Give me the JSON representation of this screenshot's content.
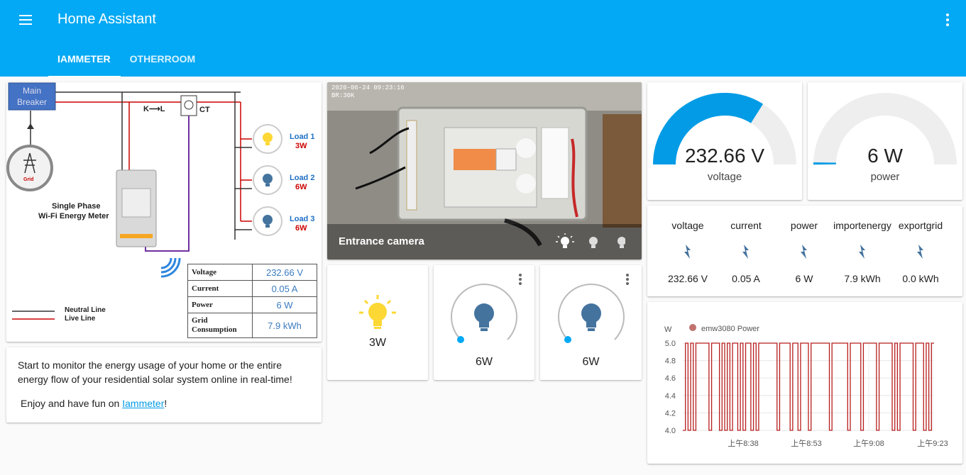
{
  "app": {
    "title": "Home Assistant"
  },
  "tabs": [
    {
      "label": "IAMMETER",
      "active": true
    },
    {
      "label": "OTHERROOM",
      "active": false
    }
  ],
  "diagram": {
    "main_breaker": "Main\nBreaker",
    "direction": "K",
    "direction_to": "L",
    "ct": "CT",
    "grid": "Grid",
    "meter_line1": "Single Phase",
    "meter_line2": "Wi-Fi Energy Meter",
    "loads": [
      {
        "name": "Load 1",
        "value": "3W"
      },
      {
        "name": "Load 2",
        "value": "6W"
      },
      {
        "name": "Load 3",
        "value": "6W"
      }
    ],
    "legend_neutral": "Neutral Line",
    "legend_live": "Live Line",
    "table": [
      {
        "label": "Voltage",
        "value": "232.66 V"
      },
      {
        "label": "Current",
        "value": "0.05 A"
      },
      {
        "label": "Power",
        "value": "6 W"
      },
      {
        "label": "Grid Consumption",
        "value": "7.9 kWh"
      }
    ]
  },
  "markdown": {
    "text1": "Start to monitor the energy usage of your home or the entire energy flow of your residential solar system online in real-time!",
    "enjoy_prefix": "Enjoy and have fun on ",
    "link": "Iammeter",
    "suffix": "!"
  },
  "camera": {
    "title": "Entrance camera",
    "timestamp": "2020-06-24 09:23:16",
    "sub": "BR:30K"
  },
  "gauges": [
    {
      "value": "232.66 V",
      "name": "voltage",
      "fraction": 0.68
    },
    {
      "value": "6 W",
      "name": "power",
      "fraction": 0.01
    }
  ],
  "glance": [
    {
      "name": "voltage",
      "state": "232.66 V",
      "icon": "flash-icon"
    },
    {
      "name": "current",
      "state": "0.05 A",
      "icon": "flash-icon"
    },
    {
      "name": "power",
      "state": "6 W",
      "icon": "flash-icon"
    },
    {
      "name": "importenergy",
      "state": "7.9 kWh",
      "icon": "flash-icon"
    },
    {
      "name": "exportgrid",
      "state": "0.0 kWh",
      "icon": "flash-icon"
    }
  ],
  "lights": [
    {
      "state": "3W",
      "on": true
    },
    {
      "state": "6W",
      "on": false,
      "brightness": 0
    },
    {
      "state": "6W",
      "on": false,
      "brightness": 0
    }
  ],
  "colors": {
    "primary": "#03a9f4",
    "light_on": "#fdd835",
    "light_off": "#44739e",
    "chart_line": "#b71c1c"
  },
  "chart_data": {
    "type": "line",
    "ylabel": "W",
    "series": [
      {
        "name": "emw3080 Power"
      }
    ],
    "ylim": [
      4.0,
      5.0
    ],
    "yticks": [
      "5.0",
      "4.8",
      "4.6",
      "4.4",
      "4.2",
      "4.0"
    ],
    "xticks": [
      "上午8:38",
      "上午8:53",
      "上午9:08",
      "上午9:23"
    ],
    "values": [
      4,
      5,
      4,
      5,
      4,
      5,
      5,
      5,
      5,
      5,
      4,
      5,
      5,
      5,
      4,
      5,
      4,
      5,
      4,
      5,
      5,
      4,
      5,
      4,
      5,
      5,
      4,
      5,
      4,
      5,
      5,
      5,
      5,
      5,
      5,
      5,
      4,
      5,
      5,
      5,
      5,
      4,
      5,
      5,
      4,
      5,
      5,
      5,
      4,
      5,
      5,
      5,
      5,
      5,
      5,
      5,
      4,
      5,
      5,
      5,
      5,
      5,
      5,
      4,
      5,
      5,
      5,
      5,
      4,
      5,
      5,
      5,
      5,
      5,
      4,
      5,
      5,
      5,
      5,
      5,
      4,
      5,
      4,
      5,
      5,
      5,
      5,
      5,
      4,
      5,
      5,
      5,
      4,
      5,
      4,
      5
    ]
  }
}
